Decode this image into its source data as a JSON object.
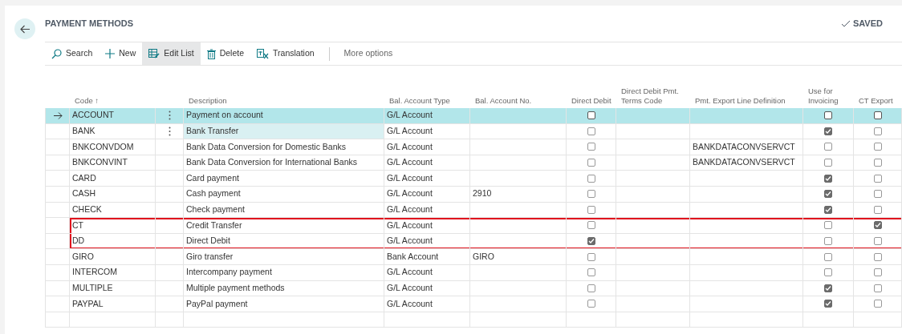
{
  "page": {
    "title": "PAYMENT METHODS",
    "status": "SAVED"
  },
  "toolbar": [
    {
      "kind": "search",
      "label": "Search",
      "selected": false
    },
    {
      "kind": "new",
      "label": "New",
      "selected": false
    },
    {
      "kind": "edit",
      "label": "Edit List",
      "selected": true
    },
    {
      "kind": "delete",
      "label": "Delete",
      "selected": false
    },
    {
      "kind": "translate",
      "label": "Translation",
      "selected": false
    },
    {
      "kind": "more",
      "label": "More options",
      "selected": false
    }
  ],
  "table": {
    "columns": [
      "Code ↑",
      "Description",
      "Bal. Account Type",
      "Bal. Account No.",
      "Direct Debit",
      "Direct Debit Pmt. Terms Code",
      "Pmt. Export Line Definition",
      "Use for Invoicing",
      "CT Export"
    ],
    "rows": [
      {
        "code": "ACCOUNT",
        "description": "Payment on account",
        "type": "G/L Account",
        "no": "",
        "direct_debit": false,
        "terms": "",
        "export_def": "",
        "invoicing": false,
        "ct_export": false,
        "selected": true,
        "hovered": false,
        "highlighted": false
      },
      {
        "code": "BANK",
        "description": "Bank Transfer",
        "type": "G/L Account",
        "no": "",
        "direct_debit": false,
        "terms": "",
        "export_def": "",
        "invoicing": true,
        "ct_export": false,
        "selected": false,
        "hovered": true,
        "highlighted": false
      },
      {
        "code": "BNKCONVDOM",
        "description": "Bank Data Conversion for Domestic Banks",
        "type": "G/L Account",
        "no": "",
        "direct_debit": false,
        "terms": "",
        "export_def": "BANKDATACONVSERVCT",
        "invoicing": false,
        "ct_export": false,
        "selected": false,
        "hovered": false,
        "highlighted": false
      },
      {
        "code": "BNKCONVINT",
        "description": "Bank Data Conversion for International Banks",
        "type": "G/L Account",
        "no": "",
        "direct_debit": false,
        "terms": "",
        "export_def": "BANKDATACONVSERVCT",
        "invoicing": false,
        "ct_export": false,
        "selected": false,
        "hovered": false,
        "highlighted": false
      },
      {
        "code": "CARD",
        "description": "Card payment",
        "type": "G/L Account",
        "no": "",
        "direct_debit": false,
        "terms": "",
        "export_def": "",
        "invoicing": true,
        "ct_export": false,
        "selected": false,
        "hovered": false,
        "highlighted": false
      },
      {
        "code": "CASH",
        "description": "Cash payment",
        "type": "G/L Account",
        "no": "2910",
        "direct_debit": false,
        "terms": "",
        "export_def": "",
        "invoicing": true,
        "ct_export": false,
        "selected": false,
        "hovered": false,
        "highlighted": false
      },
      {
        "code": "CHECK",
        "description": "Check payment",
        "type": "G/L Account",
        "no": "",
        "direct_debit": false,
        "terms": "",
        "export_def": "",
        "invoicing": true,
        "ct_export": false,
        "selected": false,
        "hovered": false,
        "highlighted": false
      },
      {
        "code": "CT",
        "description": "Credit Transfer",
        "type": "G/L Account",
        "no": "",
        "direct_debit": false,
        "terms": "",
        "export_def": "",
        "invoicing": false,
        "ct_export": true,
        "selected": false,
        "hovered": false,
        "highlighted": true
      },
      {
        "code": "DD",
        "description": "Direct Debit",
        "type": "G/L Account",
        "no": "",
        "direct_debit": true,
        "terms": "",
        "export_def": "",
        "invoicing": false,
        "ct_export": false,
        "selected": false,
        "hovered": false,
        "highlighted": true
      },
      {
        "code": "GIRO",
        "description": "Giro transfer",
        "type": "Bank Account",
        "no": "GIRO",
        "direct_debit": false,
        "terms": "",
        "export_def": "",
        "invoicing": false,
        "ct_export": false,
        "selected": false,
        "hovered": false,
        "highlighted": false
      },
      {
        "code": "INTERCOM",
        "description": "Intercompany payment",
        "type": "G/L Account",
        "no": "",
        "direct_debit": false,
        "terms": "",
        "export_def": "",
        "invoicing": false,
        "ct_export": false,
        "selected": false,
        "hovered": false,
        "highlighted": false
      },
      {
        "code": "MULTIPLE",
        "description": "Multiple payment methods",
        "type": "G/L Account",
        "no": "",
        "direct_debit": false,
        "terms": "",
        "export_def": "",
        "invoicing": true,
        "ct_export": false,
        "selected": false,
        "hovered": false,
        "highlighted": false
      },
      {
        "code": "PAYPAL",
        "description": "PayPal payment",
        "type": "G/L Account",
        "no": "",
        "direct_debit": false,
        "terms": "",
        "export_def": "",
        "invoicing": true,
        "ct_export": false,
        "selected": false,
        "hovered": false,
        "highlighted": false
      }
    ]
  }
}
